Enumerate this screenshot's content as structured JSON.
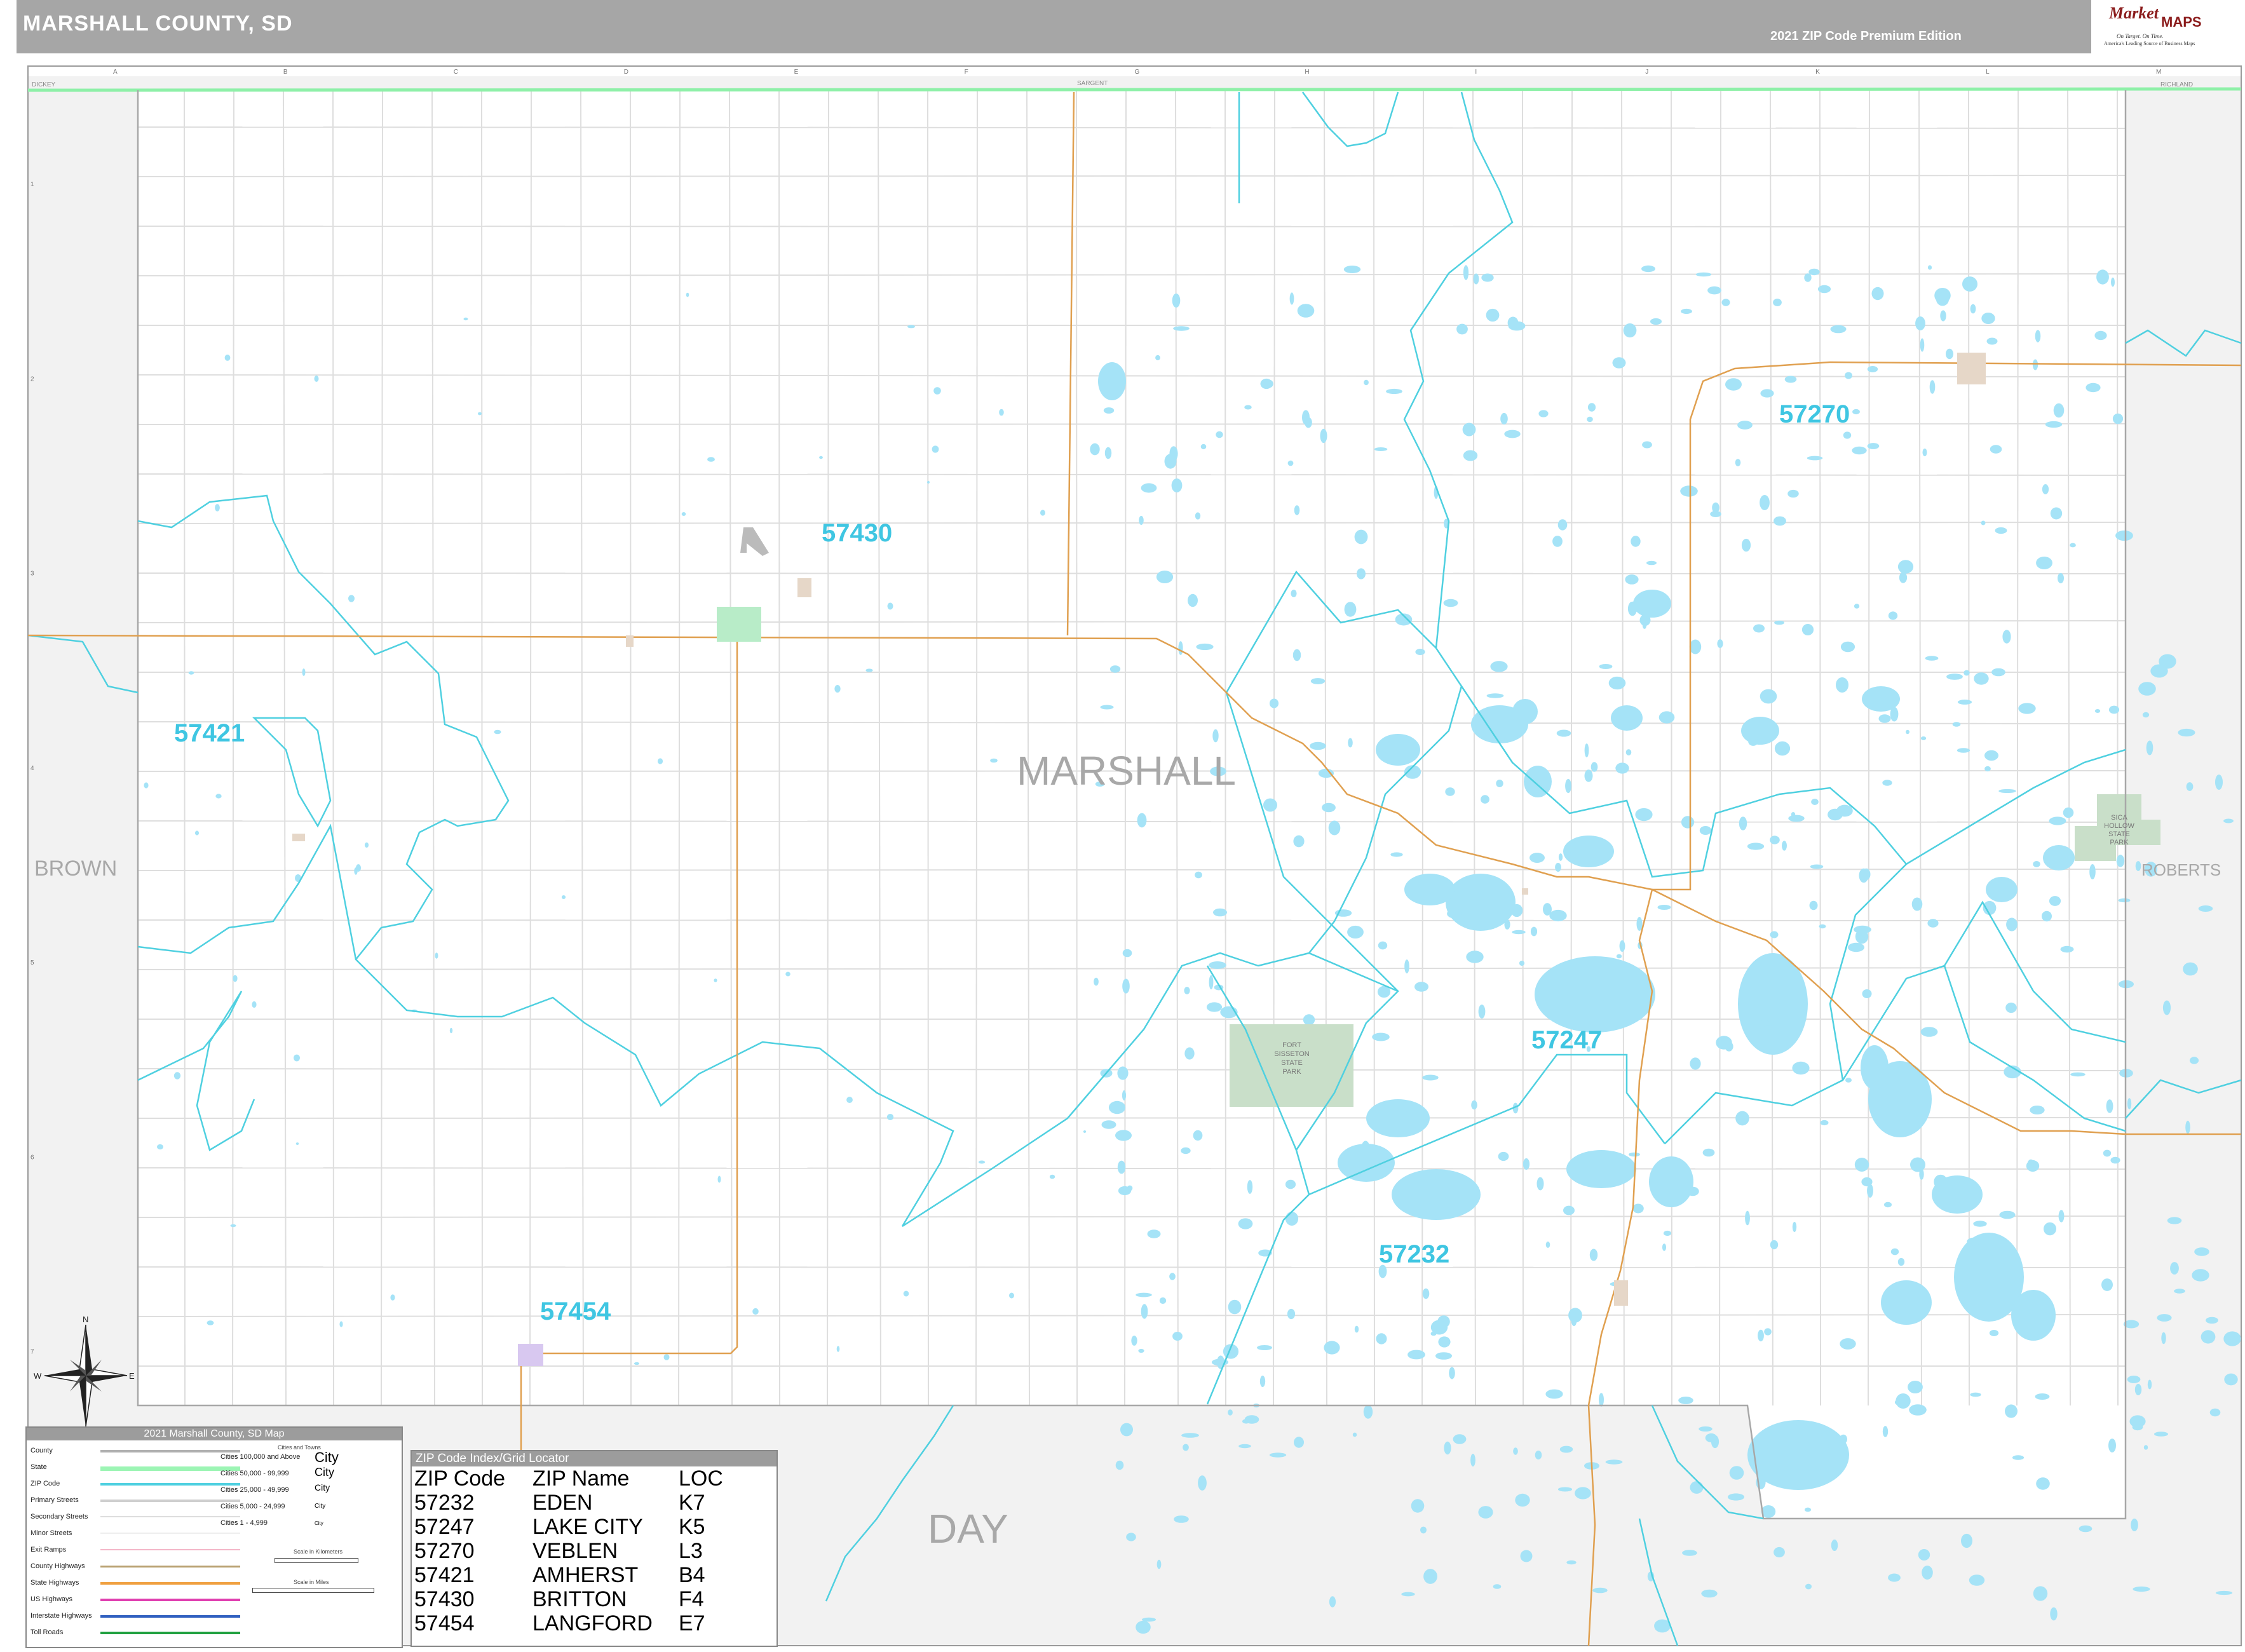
{
  "header": {
    "title": "MARSHALL COUNTY, SD",
    "edition": "2021 ZIP Code Premium Edition"
  },
  "logo": {
    "brand": "Market",
    "brand2": "MAPS",
    "tagline": "On Target. On Time.",
    "tagline2": "America's Leading Source of Business Maps"
  },
  "grid": {
    "columns": [
      "A",
      "B",
      "C",
      "D",
      "E",
      "F",
      "G",
      "H",
      "I",
      "J",
      "K",
      "L",
      "M"
    ],
    "rows": [
      "1",
      "2",
      "3",
      "4",
      "5",
      "6",
      "7",
      "8"
    ]
  },
  "counties": {
    "center": "MARSHALL",
    "west": "BROWN",
    "east": "ROBERTS",
    "south": "DAY",
    "north_west": "DICKEY",
    "north_mid": "SARGENT",
    "north_east": "RICHLAND"
  },
  "zip_labels": [
    "57270",
    "57430",
    "57421",
    "57247",
    "57232",
    "57454"
  ],
  "park_labels": {
    "fort_sisseton": [
      "FORT",
      "SISSETON",
      "STATE",
      "PARK"
    ],
    "sica_hollow": [
      "SICA",
      "HOLLOW",
      "STATE",
      "PARK"
    ]
  },
  "compass": {
    "n": "N",
    "s": "S",
    "e": "E",
    "w": "W"
  },
  "legend": {
    "title": "2021 Marshall County, SD Map",
    "items": [
      "County",
      "State",
      "ZIP Code",
      "Primary Streets",
      "Secondary Streets",
      "Minor Streets",
      "Exit Ramps",
      "County Highways",
      "State Highways",
      "US Highways",
      "Interstate Highways",
      "Toll Roads"
    ],
    "cities_header": "Cities and Towns",
    "cities": [
      {
        "label": "Cities 100,000 and Above",
        "sample": "City"
      },
      {
        "label": "Cities 50,000 - 99,999",
        "sample": "City"
      },
      {
        "label": "Cities 25,000 - 49,999",
        "sample": "City"
      },
      {
        "label": "Cities 5,000 - 24,999",
        "sample": "City"
      },
      {
        "label": "Cities 1 - 4,999",
        "sample": "City"
      }
    ],
    "scale_km": "Scale in Kilometers",
    "scale_mi": "Scale in Miles",
    "colors": {
      "county": "#b0b0b0",
      "state": "#9cf5b4",
      "zip": "#4fd0e0",
      "primary": "#cfcfcf",
      "secondary": "#dddddd",
      "minor": "#eeeeee",
      "exit": "#f4b6c8",
      "county_hwy": "#b8a070",
      "state_hwy": "#f0a040",
      "us_hwy": "#e040b0",
      "interstate": "#3060c0",
      "toll": "#20a040"
    }
  },
  "zip_index": {
    "title": "ZIP Code Index/Grid Locator",
    "headers": [
      "ZIP Code",
      "ZIP Name",
      "LOC"
    ],
    "rows": [
      [
        "57232",
        "EDEN",
        "K7"
      ],
      [
        "57247",
        "LAKE CITY",
        "K5"
      ],
      [
        "57270",
        "VEBLEN",
        "L3"
      ],
      [
        "57421",
        "AMHERST",
        "B4"
      ],
      [
        "57430",
        "BRITTON",
        "F4"
      ],
      [
        "57454",
        "LANGFORD",
        "E7"
      ]
    ]
  },
  "colors": {
    "water": "#a5e3f7",
    "zip_line": "#4fd0e0",
    "zip_text": "#3fc6e2",
    "state_line": "#8ef0a8",
    "road": "#e0a050",
    "neighbor": "#f2f2f2",
    "park": "#c9dfc9"
  }
}
